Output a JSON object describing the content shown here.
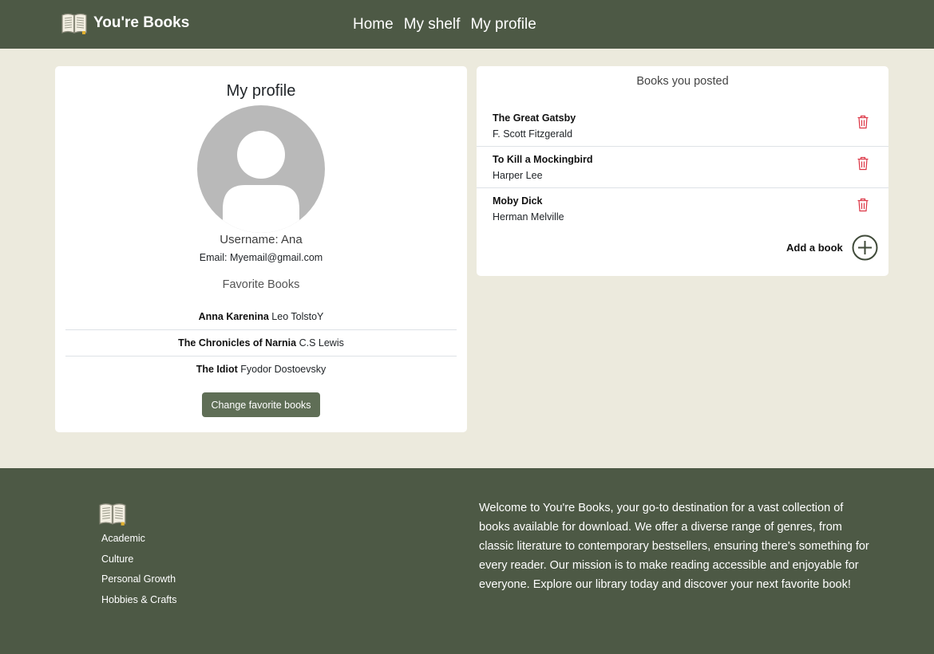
{
  "brand": {
    "name": "You're Books",
    "logo_icon": "open-book-icon"
  },
  "nav": {
    "links": [
      "Home",
      "My shelf",
      "My profile"
    ]
  },
  "profile": {
    "title": "My profile",
    "avatar_icon": "user-avatar-icon",
    "username": "Username: Ana",
    "email": "Email: Myemail@gmail.com",
    "favorites_title": "Favorite Books",
    "favorites": [
      {
        "title": "Anna Karenina",
        "author": "Leo TolstoY"
      },
      {
        "title": "The Chronicles of Narnia",
        "author": "C.S Lewis"
      },
      {
        "title": "The Idiot",
        "author": "Fyodor Dostoevsky"
      }
    ],
    "change_button": "Change favorite books"
  },
  "posted": {
    "title": "Books you posted",
    "books": [
      {
        "title": "The Great Gatsby",
        "author": "F. Scott Fitzgerald"
      },
      {
        "title": "To Kill a Mockingbird",
        "author": "Harper Lee"
      },
      {
        "title": "Moby Dick",
        "author": "Herman Melville"
      }
    ],
    "delete_icon": "trash-icon",
    "add_label": "Add a book",
    "add_icon": "plus-circle-icon"
  },
  "footer": {
    "logo_icon": "open-book-icon",
    "links": [
      "Academic",
      "Culture",
      "Personal Growth",
      "Hobbies & Crafts"
    ],
    "about": "Welcome to You're Books, your go-to destination for a vast collection of books available for download. We offer a diverse range of genres, from classic literature to contemporary bestsellers, ensuring there's something for every reader. Our mission is to make reading accessible and enjoyable for everyone. Explore our library today and discover your next favorite book!"
  },
  "colors": {
    "header_footer_bg": "#4d5945",
    "page_bg": "#eceadd",
    "button_bg": "#5f6e56",
    "delete_red": "#dc3545"
  }
}
